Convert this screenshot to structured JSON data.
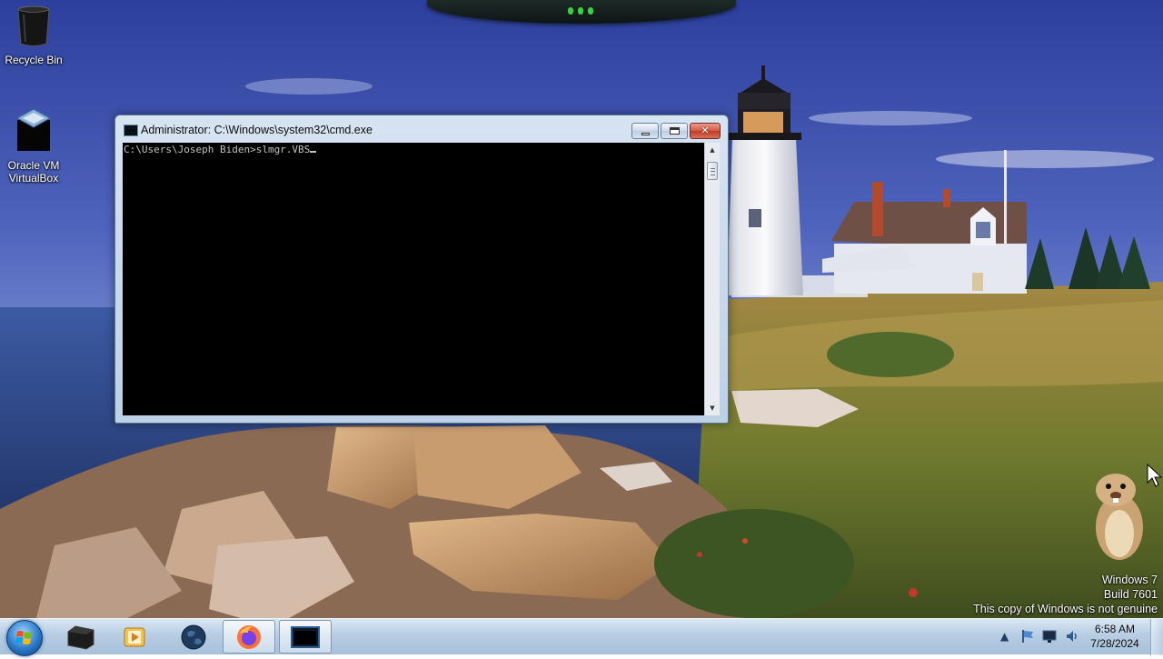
{
  "desktop": {
    "icons": [
      {
        "label": "Recycle Bin"
      },
      {
        "label": "Oracle VM VirtualBox"
      }
    ]
  },
  "cmd_window": {
    "title": "Administrator: C:\\Windows\\system32\\cmd.exe",
    "console_text": "C:\\Users\\Joseph Biden>slmgr.VBS"
  },
  "watermark": {
    "line1": "Windows 7",
    "line2": "Build 7601",
    "line3": "This copy of Windows is not genuine"
  },
  "taskbar": {
    "pinned": [
      {
        "icon": "start-orb-icon"
      },
      {
        "icon": "terminal-app-icon"
      },
      {
        "icon": "media-player-icon"
      },
      {
        "icon": "globe-icon"
      },
      {
        "icon": "firefox-icon"
      },
      {
        "icon": "cmd-icon"
      }
    ],
    "tray": {
      "icons": [
        "show-hidden-icon",
        "flag-icon",
        "network-icon",
        "volume-icon"
      ],
      "time": "6:58 AM",
      "date": "7/28/2024"
    }
  },
  "colors": {
    "console_bg": "#000000",
    "console_fg": "#c0c0c0",
    "taskbar": "#b7cde2",
    "close_button": "#c23b22"
  }
}
